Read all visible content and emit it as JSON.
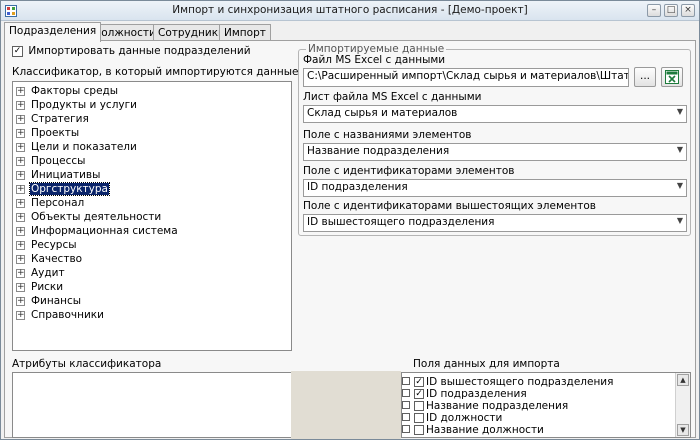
{
  "window": {
    "title": "Импорт и синхронизация штатного расписания - [Демо-проект]",
    "minimize_glyph": "–",
    "maximize_glyph": "□",
    "close_glyph": "×"
  },
  "tabs": [
    "Подразделения",
    "Должности",
    "Сотрудники",
    "Импорт"
  ],
  "left": {
    "import_checkbox_label": "Импортировать данные подразделений",
    "import_checked": true,
    "classifier_label": "Классификатор, в который импортируются данные",
    "tree_items": [
      "Факторы среды",
      "Продукты и услуги",
      "Стратегия",
      "Проекты",
      "Цели и показатели",
      "Процессы",
      "Инициативы",
      "Оргструктура",
      "Персонал",
      "Объекты деятельности",
      "Информационная система",
      "Ресурсы",
      "Качество",
      "Аудит",
      "Риски",
      "Финансы",
      "Справочники"
    ],
    "selected_item": "Оргструктура",
    "attributes_label": "Атрибуты классификатора"
  },
  "imported": {
    "legend": "Импортируемые данные",
    "file_label": "Файл MS Excel с данными",
    "file_path": "C:\\Расширенный импорт\\Склад сырья и материалов\\Штатное распи",
    "browse_label": "...",
    "sheet_label": "Лист файла MS Excel с данными",
    "sheet_value": "Склад сырья и материалов",
    "names_label": "Поле с названиями элементов",
    "names_value": "Название подразделения",
    "ids_label": "Поле с идентификаторами элементов",
    "ids_value": "ID подразделения",
    "parent_ids_label": "Поле с идентификаторами вышестоящих элементов",
    "parent_ids_value": "ID вышестоящего подразделения"
  },
  "fields_for_import": {
    "label": "Поля данных для импорта",
    "items": [
      {
        "label": "ID вышестоящего подразделения",
        "checked": true
      },
      {
        "label": "ID подразделения",
        "checked": true
      },
      {
        "label": "Название подразделения",
        "checked": false
      },
      {
        "label": "ID должности",
        "checked": false
      },
      {
        "label": "Название должности",
        "checked": false
      }
    ]
  },
  "colors": {
    "selection": "#0a246a",
    "excel_icon": "#1e7b3c"
  }
}
